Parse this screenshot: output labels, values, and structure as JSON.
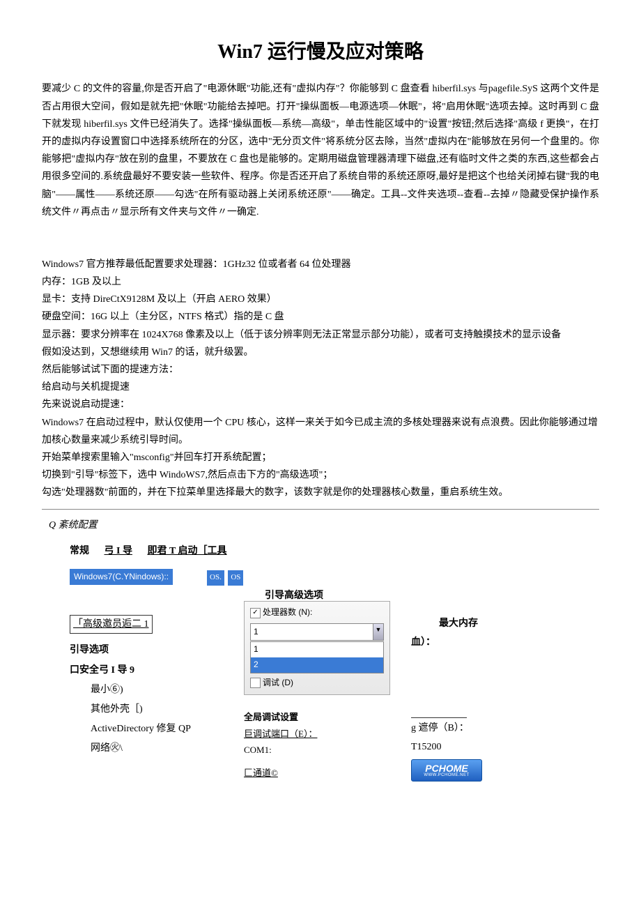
{
  "title": "Win7 运行慢及应对策略",
  "para1": "要减少 C 的文件的容量,你是否开启了\"电源休眠\"功能,还有\"虚拟内存\"？你能够到 C 盘查看 hiberfil.sys 与pagefile.SyS 这两个文件是否占用很大空间，假如是就先把\"休眠\"功能给去掉吧。打开\"操纵面板—电源选项—休眠\"，将\"启用休眠\"选项去掉。这时再到 C 盘下就发现 hiberfil.sys 文件已经消失了。选择\"操纵面板—系统—高级\"，单击性能区域中的\"设置\"按钮;然后选择\"高级 f 更换\"，在打开的虚拟内存设置窗口中选择系统所在的分区，选中\"无分页文件\"将系统分区去除，当然\"虚拟内在\"能够放在另何一个盘里的。你能够把\"虚拟内存\"放在别的盘里，不要放在 C 盘也是能够的。定期用磁盘管理器清理下磁盘,还有临时文件之类的东西,这些都会占用很多空间的.系统盘最好不要安装一些软件、程序。你是否还开启了系统自带的系统还原呀,最好是把这个也给关闭掉右键\"我的电脑\"——属性——系统还原——勾选\"在所有驱动器上关闭系统还原\"——确定。工具--文件夹选项--查看--去掉〃隐藏受保护操作系统文件〃再点击〃显示所有文件夹与文件〃一确定.",
  "specs": {
    "l1": "Windows7 官方推荐最低配置要求处理器：1GHz32 位或者者 64 位处理器",
    "l2": "内存：1GB 及以上",
    "l3": "显卡：支持 DireCtX9128M 及以上（开启 AERO 效果）",
    "l4": "硬盘空间：16G 以上（主分区，NTFS 格式）指的是 C 盘",
    "l5": "显示器：要求分辨率在 1024X768 像素及以上（低于该分辨率则无法正常显示部分功能），或者可支持触摸技术的显示设备",
    "l6": "假如没达到，又想继续用 Win7 的话，就升级罢。",
    "l7": "然后能够试试下面的提速方法：",
    "l8": "给启动与关机提提速",
    "l9": "先来说说启动提速：",
    "l10": "Windows7 在启动过程中，默认仅使用一个 CPU 核心，这样一来关于如今已成主流的多核处理器来说有点浪费。因此你能够通过增加核心数量来减少系统引导时间。",
    "l11": "开始菜单搜索里输入\"msconfig\"并回车打开系统配置；",
    "l12": "切换到\"引导\"标签下，选中 WindoWS7,然后点击下方的\"高级选项\"；",
    "l13": "勾选\"处理器数\"前面的，并在下拉菜单里选择最大的数字，该数字就是你的处理器核心数量，重启系统生效。"
  },
  "sc": {
    "title": "Q 紊统配置",
    "tab1": "常规",
    "tab2": "弓 I 导",
    "tab3": "即君 T 启动［工具",
    "bootentry": "Windows7(C.YNindows)::",
    "os1": "OS.",
    "os2": "OS",
    "advlabel": "引导高级选项",
    "advlink": "「高级邀员逅二 1",
    "bootoptions": "引导选项",
    "safeboot": "口安全弓 I 导 9",
    "min": "最小⑥)",
    "shell": "其他外壳［)",
    "ad": "ActiveDirectory 修复 QP",
    "net": "网络㊋\\",
    "procnum": "处理器数 (N):",
    "dd_sel": "1",
    "dd_o1": "1",
    "dd_o2": "2",
    "debug_cb": "调试 (D)",
    "maxmem": "最大内存",
    "maxmem2": "血）：",
    "globaldbg": "全局调试设置",
    "dbgport": "巨调试端口（E）：",
    "com1": "COM1:",
    "channel": "匚通道©",
    "baud_lbl": "g 遮停（B）：",
    "baud_val": "T15200",
    "logo": "PCHOME",
    "logo_sub": "WWW.PCHOME.NET"
  }
}
